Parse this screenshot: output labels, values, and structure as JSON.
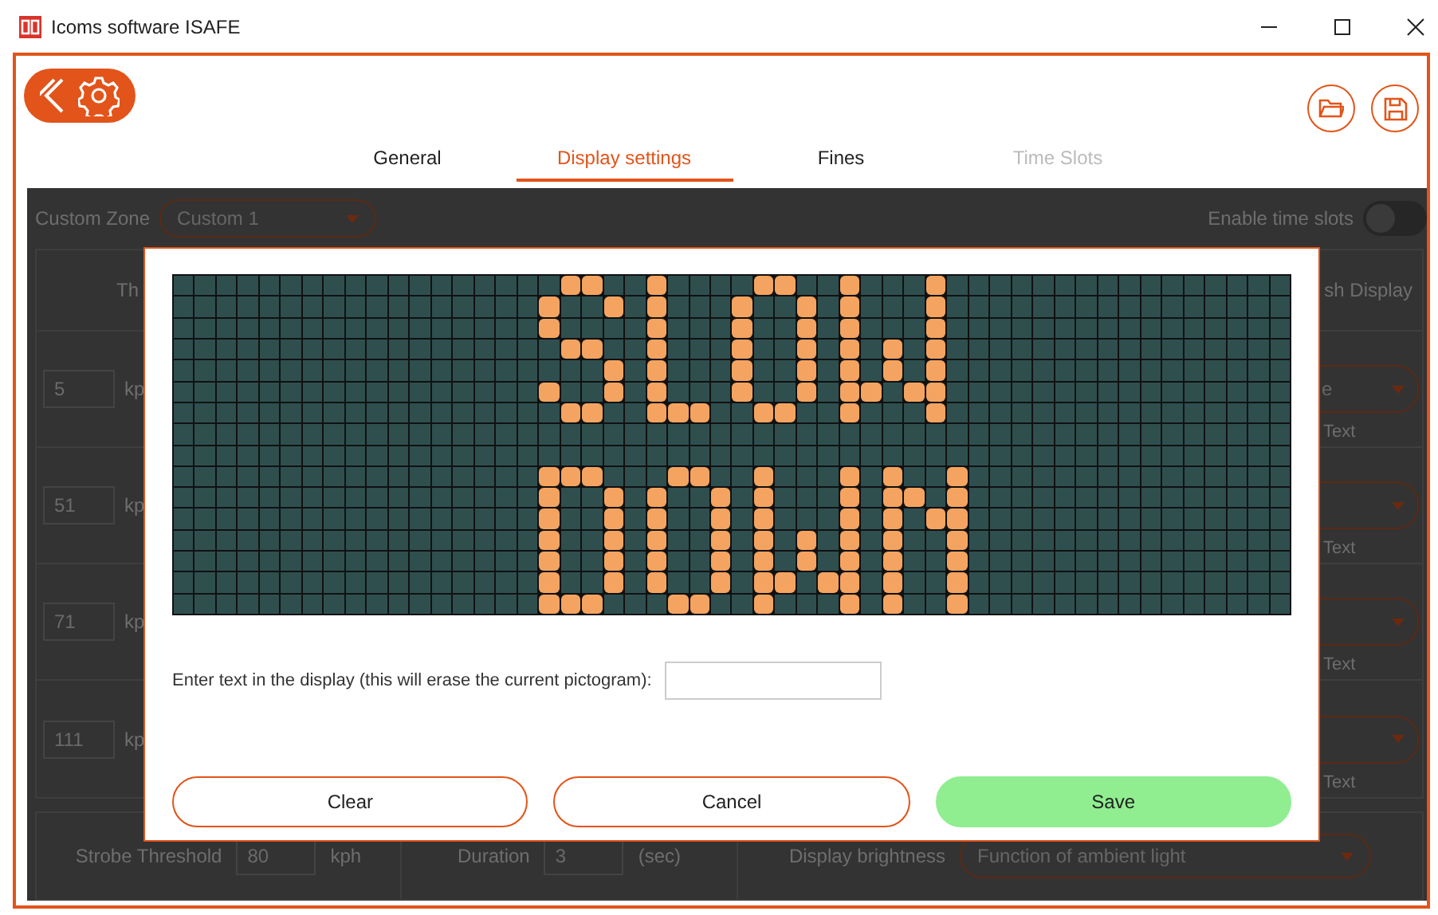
{
  "window": {
    "title": "Icoms software ISAFE"
  },
  "tabs": [
    {
      "label": "General",
      "selected": false,
      "disabled": false
    },
    {
      "label": "Display settings",
      "selected": true,
      "disabled": false
    },
    {
      "label": "Fines",
      "selected": false,
      "disabled": false
    },
    {
      "label": "Time Slots",
      "selected": false,
      "disabled": true
    }
  ],
  "zone": {
    "label": "Custom Zone",
    "value": "Custom 1"
  },
  "time_slots": {
    "label": "Enable time slots",
    "on": false
  },
  "table": {
    "column_1_heading": "Th",
    "column_2_heading": "sh Display",
    "rows": [
      {
        "threshold": "5",
        "unit": "kp",
        "mode": "e",
        "label": "Text"
      },
      {
        "threshold": "51",
        "unit": "kp",
        "label": "Text"
      },
      {
        "threshold": "71",
        "unit": "kp",
        "label": "Text"
      },
      {
        "threshold": "111",
        "unit": "kp",
        "label": "Text"
      }
    ]
  },
  "strobe": {
    "label": "Strobe Threshold",
    "value": "80",
    "unit": "kph"
  },
  "duration": {
    "label": "Duration",
    "value": "3",
    "unit": "(sec)"
  },
  "brightness": {
    "label": "Display brightness",
    "value": "Function of ambient light"
  },
  "dialog": {
    "prompt": "Enter text in the display (this will erase the current pictogram):",
    "led_rows": [
      [
        false,
        false,
        false,
        false,
        false,
        false,
        false,
        false,
        false,
        false,
        false,
        false,
        false,
        false,
        false,
        false,
        false,
        false,
        true,
        true,
        false,
        false,
        true,
        false,
        false,
        false,
        false,
        true,
        true,
        false,
        false,
        true,
        false,
        false,
        false,
        true,
        false,
        false,
        false,
        false,
        false,
        false,
        false,
        false,
        false,
        false,
        false,
        false,
        false,
        false,
        false,
        false
      ],
      [
        false,
        false,
        false,
        false,
        false,
        false,
        false,
        false,
        false,
        false,
        false,
        false,
        false,
        false,
        false,
        false,
        false,
        true,
        false,
        false,
        true,
        false,
        true,
        false,
        false,
        false,
        true,
        false,
        false,
        true,
        false,
        true,
        false,
        false,
        false,
        true,
        false,
        false,
        false,
        false,
        false,
        false,
        false,
        false,
        false,
        false,
        false,
        false,
        false,
        false,
        false,
        false
      ],
      [
        false,
        false,
        false,
        false,
        false,
        false,
        false,
        false,
        false,
        false,
        false,
        false,
        false,
        false,
        false,
        false,
        false,
        true,
        false,
        false,
        false,
        false,
        true,
        false,
        false,
        false,
        true,
        false,
        false,
        true,
        false,
        true,
        false,
        false,
        false,
        true,
        false,
        false,
        false,
        false,
        false,
        false,
        false,
        false,
        false,
        false,
        false,
        false,
        false,
        false,
        false,
        false
      ],
      [
        false,
        false,
        false,
        false,
        false,
        false,
        false,
        false,
        false,
        false,
        false,
        false,
        false,
        false,
        false,
        false,
        false,
        false,
        true,
        true,
        false,
        false,
        true,
        false,
        false,
        false,
        true,
        false,
        false,
        true,
        false,
        true,
        false,
        true,
        false,
        true,
        false,
        false,
        false,
        false,
        false,
        false,
        false,
        false,
        false,
        false,
        false,
        false,
        false,
        false,
        false,
        false
      ],
      [
        false,
        false,
        false,
        false,
        false,
        false,
        false,
        false,
        false,
        false,
        false,
        false,
        false,
        false,
        false,
        false,
        false,
        false,
        false,
        false,
        true,
        false,
        true,
        false,
        false,
        false,
        true,
        false,
        false,
        true,
        false,
        true,
        false,
        true,
        false,
        true,
        false,
        false,
        false,
        false,
        false,
        false,
        false,
        false,
        false,
        false,
        false,
        false,
        false,
        false,
        false,
        false
      ],
      [
        false,
        false,
        false,
        false,
        false,
        false,
        false,
        false,
        false,
        false,
        false,
        false,
        false,
        false,
        false,
        false,
        false,
        true,
        false,
        false,
        true,
        false,
        true,
        false,
        false,
        false,
        true,
        false,
        false,
        true,
        false,
        true,
        true,
        false,
        true,
        true,
        false,
        false,
        false,
        false,
        false,
        false,
        false,
        false,
        false,
        false,
        false,
        false,
        false,
        false,
        false,
        false
      ],
      [
        false,
        false,
        false,
        false,
        false,
        false,
        false,
        false,
        false,
        false,
        false,
        false,
        false,
        false,
        false,
        false,
        false,
        false,
        true,
        true,
        false,
        false,
        true,
        true,
        true,
        false,
        false,
        true,
        true,
        false,
        false,
        true,
        false,
        false,
        false,
        true,
        false,
        false,
        false,
        false,
        false,
        false,
        false,
        false,
        false,
        false,
        false,
        false,
        false,
        false,
        false,
        false
      ],
      [
        false,
        false,
        false,
        false,
        false,
        false,
        false,
        false,
        false,
        false,
        false,
        false,
        false,
        false,
        false,
        false,
        false,
        false,
        false,
        false,
        false,
        false,
        false,
        false,
        false,
        false,
        false,
        false,
        false,
        false,
        false,
        false,
        false,
        false,
        false,
        false,
        false,
        false,
        false,
        false,
        false,
        false,
        false,
        false,
        false,
        false,
        false,
        false,
        false,
        false,
        false,
        false
      ],
      [
        false,
        false,
        false,
        false,
        false,
        false,
        false,
        false,
        false,
        false,
        false,
        false,
        false,
        false,
        false,
        false,
        false,
        false,
        false,
        false,
        false,
        false,
        false,
        false,
        false,
        false,
        false,
        false,
        false,
        false,
        false,
        false,
        false,
        false,
        false,
        false,
        false,
        false,
        false,
        false,
        false,
        false,
        false,
        false,
        false,
        false,
        false,
        false,
        false,
        false,
        false,
        false
      ],
      [
        false,
        false,
        false,
        false,
        false,
        false,
        false,
        false,
        false,
        false,
        false,
        false,
        false,
        false,
        false,
        false,
        false,
        true,
        true,
        true,
        false,
        false,
        false,
        true,
        true,
        false,
        false,
        true,
        false,
        false,
        false,
        true,
        false,
        true,
        false,
        false,
        true,
        false,
        false,
        false,
        false,
        false,
        false,
        false,
        false,
        false,
        false,
        false,
        false,
        false,
        false,
        false
      ],
      [
        false,
        false,
        false,
        false,
        false,
        false,
        false,
        false,
        false,
        false,
        false,
        false,
        false,
        false,
        false,
        false,
        false,
        true,
        false,
        false,
        true,
        false,
        true,
        false,
        false,
        true,
        false,
        true,
        false,
        false,
        false,
        true,
        false,
        true,
        true,
        false,
        true,
        false,
        false,
        false,
        false,
        false,
        false,
        false,
        false,
        false,
        false,
        false,
        false,
        false,
        false,
        false
      ],
      [
        false,
        false,
        false,
        false,
        false,
        false,
        false,
        false,
        false,
        false,
        false,
        false,
        false,
        false,
        false,
        false,
        false,
        true,
        false,
        false,
        true,
        false,
        true,
        false,
        false,
        true,
        false,
        true,
        false,
        false,
        false,
        true,
        false,
        true,
        false,
        true,
        true,
        false,
        false,
        false,
        false,
        false,
        false,
        false,
        false,
        false,
        false,
        false,
        false,
        false,
        false,
        false
      ],
      [
        false,
        false,
        false,
        false,
        false,
        false,
        false,
        false,
        false,
        false,
        false,
        false,
        false,
        false,
        false,
        false,
        false,
        true,
        false,
        false,
        true,
        false,
        true,
        false,
        false,
        true,
        false,
        true,
        false,
        true,
        false,
        true,
        false,
        true,
        false,
        false,
        true,
        false,
        false,
        false,
        false,
        false,
        false,
        false,
        false,
        false,
        false,
        false,
        false,
        false,
        false,
        false
      ],
      [
        false,
        false,
        false,
        false,
        false,
        false,
        false,
        false,
        false,
        false,
        false,
        false,
        false,
        false,
        false,
        false,
        false,
        true,
        false,
        false,
        true,
        false,
        true,
        false,
        false,
        true,
        false,
        true,
        false,
        true,
        false,
        true,
        false,
        true,
        false,
        false,
        true,
        false,
        false,
        false,
        false,
        false,
        false,
        false,
        false,
        false,
        false,
        false,
        false,
        false,
        false,
        false
      ],
      [
        false,
        false,
        false,
        false,
        false,
        false,
        false,
        false,
        false,
        false,
        false,
        false,
        false,
        false,
        false,
        false,
        false,
        true,
        false,
        false,
        true,
        false,
        true,
        false,
        false,
        true,
        false,
        true,
        true,
        false,
        true,
        true,
        false,
        true,
        false,
        false,
        true,
        false,
        false,
        false,
        false,
        false,
        false,
        false,
        false,
        false,
        false,
        false,
        false,
        false,
        false,
        false
      ],
      [
        false,
        false,
        false,
        false,
        false,
        false,
        false,
        false,
        false,
        false,
        false,
        false,
        false,
        false,
        false,
        false,
        false,
        true,
        true,
        true,
        false,
        false,
        false,
        true,
        true,
        false,
        false,
        true,
        false,
        false,
        false,
        true,
        false,
        true,
        false,
        false,
        true,
        false,
        false,
        false,
        false,
        false,
        false,
        false,
        false,
        false,
        false,
        false,
        false,
        false,
        false,
        false
      ]
    ],
    "buttons": [
      {
        "label": "Clear",
        "kind": "outline"
      },
      {
        "label": "Cancel",
        "kind": "outline"
      },
      {
        "label": "Save",
        "kind": "primary"
      }
    ]
  }
}
